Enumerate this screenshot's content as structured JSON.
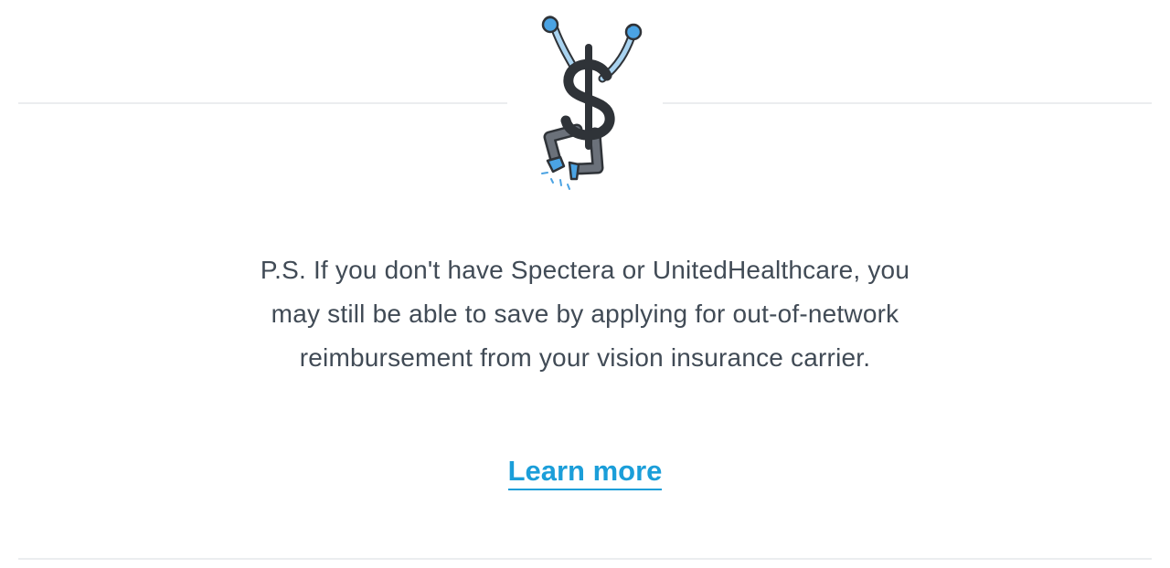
{
  "promo": {
    "ps_text": "P.S. If you don't have Spectera or UnitedHealthcare, you may still be able to save by applying for out-of-network reimbursement from your vision insurance carrier.",
    "learn_more_label": "Learn more",
    "illustration_icon": "jumping-dollar-sign-icon"
  },
  "colors": {
    "text": "#414b56",
    "link": "#1b9ed9",
    "divider": "#ebedef",
    "illustration_dark": "#2f3338",
    "illustration_blue": "#4ba3e3",
    "illustration_light_blue": "#a9d3f0",
    "illustration_gray": "#6b717a"
  }
}
